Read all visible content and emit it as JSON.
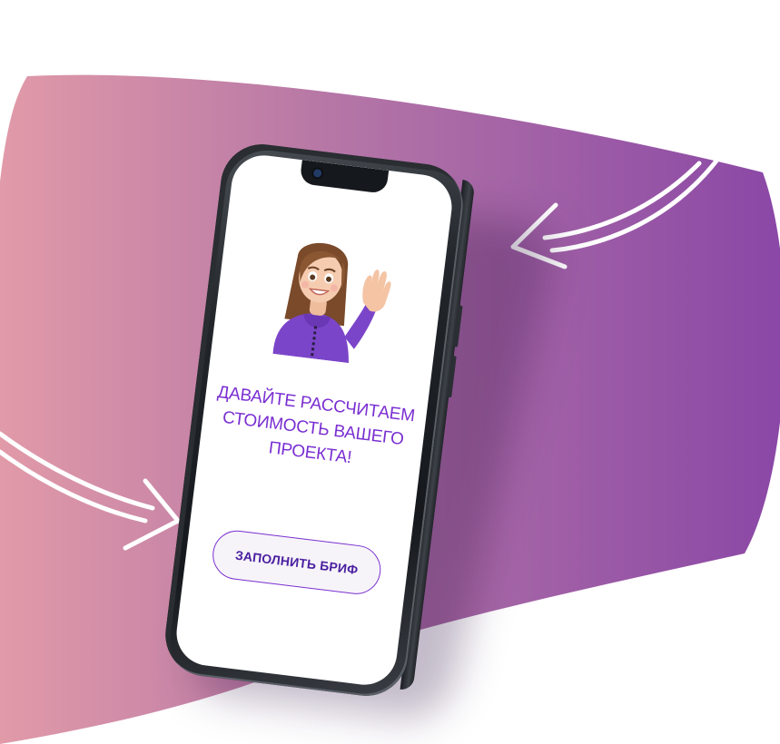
{
  "colors": {
    "gradient_start": "#e19aa8",
    "gradient_end": "#8a47a6",
    "accent": "#7a2fd1",
    "arrow": "#ffffff"
  },
  "screen": {
    "headline_line1": "ДАВАЙТЕ РАССЧИТАЕМ",
    "headline_line2": "СТОИМОСТЬ ВАШЕГО",
    "headline_line3": "ПРОЕКТА!",
    "cta_label": "ЗАПОЛНИТЬ БРИФ"
  },
  "icons": {
    "avatar": "waving-girl-memoji-icon",
    "arrow_left": "curved-arrow-right-icon",
    "arrow_right": "curved-arrow-left-icon"
  }
}
